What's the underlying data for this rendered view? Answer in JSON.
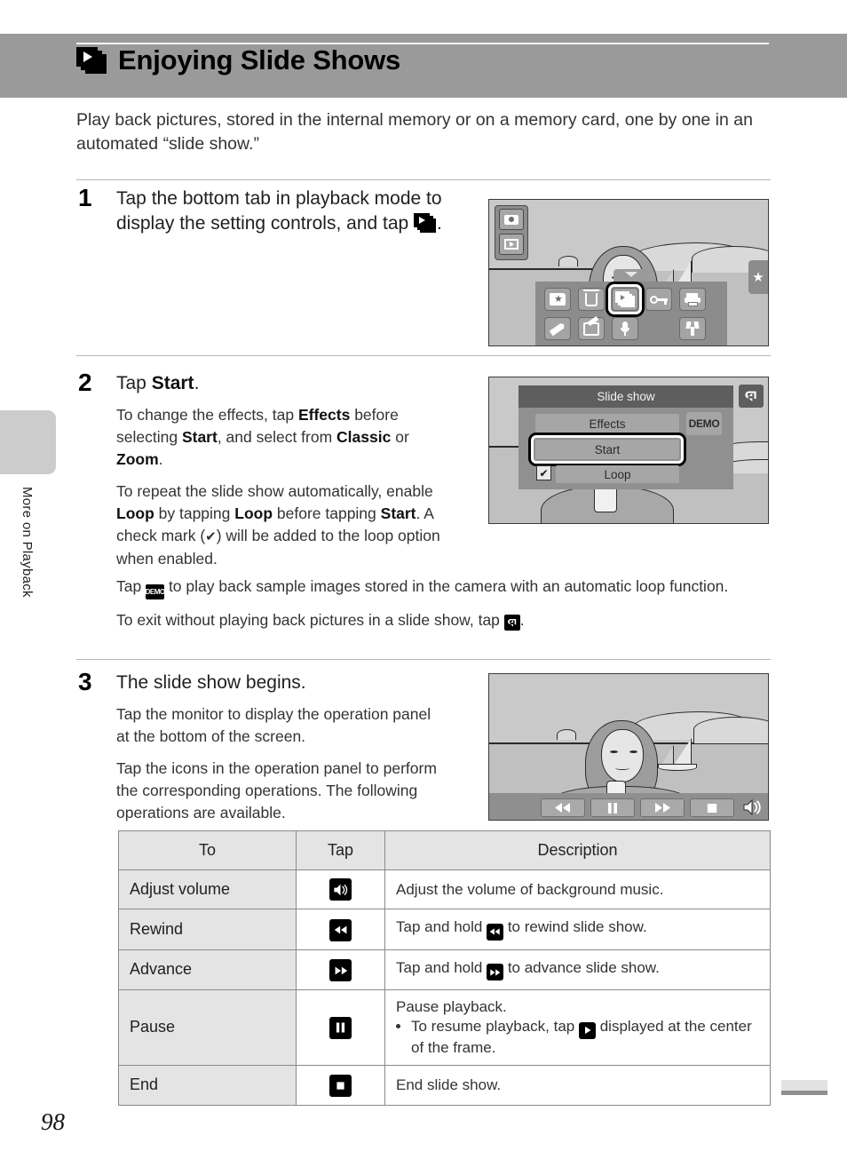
{
  "header": {
    "title": "Enjoying Slide Shows",
    "icon": "slide-show-icon"
  },
  "intro": "Play back pictures, stored in the internal memory or on a memory card, one by one in an automated “slide show.”",
  "steps": [
    {
      "number": "1",
      "heading_part1": "Tap the bottom tab in playback mode to display the setting controls, and tap ",
      "heading_part2": ".",
      "figure": {
        "name": "playback-setting-controls-screen",
        "mode_buttons": [
          "camera-mode-icon",
          "playback-mode-icon"
        ],
        "panel_icons_row1": [
          "favorites-folder-icon",
          "delete-trash-icon",
          "slide-show-icon",
          "protect-key-icon",
          "print-order-icon"
        ],
        "panel_icons_row2": [
          "d-lighting-pencil-icon",
          "edit-retouch-icon",
          "voice-memo-mic-icon",
          "setup-wrench-icon"
        ],
        "selected_icon": "slide-show-icon",
        "side_tab_icon": "favorites-star-icon"
      }
    },
    {
      "number": "2",
      "heading_plain": "Tap ",
      "heading_bold": "Start",
      "heading_end": ".",
      "paragraphs": [
        "To change the effects, tap |Effects| before selecting |Start|, and select from |Classic| or |Zoom|.",
        "To repeat the slide show automatically, enable |Loop| by tapping |Loop| before tapping |Start|. A check mark (✔) will be added to the loop option when enabled.",
        "Tap [DEMO] to play back sample images stored in the camera with an automatic loop function.",
        "To exit without playing back pictures in a slide show, tap [BACK]."
      ],
      "figure": {
        "name": "slide-show-menu-screen",
        "menu_title": "Slide show",
        "items": [
          "Effects",
          "Start",
          "Loop"
        ],
        "demo_label": "DEMO",
        "selected_item": "Start",
        "loop_checked": true,
        "back_button": "back-arrow-icon"
      }
    },
    {
      "number": "3",
      "heading": "The slide show begins.",
      "paragraphs": [
        "Tap the monitor to display the operation panel at the bottom of the screen.",
        "Tap the icons in the operation panel to perform the corresponding operations. The following operations are available."
      ],
      "figure": {
        "name": "slide-show-playback-screen",
        "op_panel_icons": [
          "rewind-icon",
          "pause-icon",
          "advance-icon",
          "end-stop-icon",
          "volume-icon"
        ]
      }
    }
  ],
  "table": {
    "headers": [
      "To",
      "Tap",
      "Description"
    ],
    "rows": [
      {
        "to": "Adjust volume",
        "tap_icon": "volume-icon",
        "description": "Adjust the volume of background music.",
        "desc_pre": "Adjust the volume of background music.",
        "desc_post": ""
      },
      {
        "to": "Rewind",
        "tap_icon": "rewind-icon",
        "description": "Tap and hold [REWIND] to rewind slide show.",
        "desc_pre": "Tap and hold ",
        "desc_post": " to rewind slide show."
      },
      {
        "to": "Advance",
        "tap_icon": "advance-icon",
        "description": "Tap and hold [ADVANCE] to advance slide show.",
        "desc_pre": "Tap and hold ",
        "desc_post": " to advance slide show."
      },
      {
        "to": "Pause",
        "tap_icon": "pause-icon",
        "description": "Pause playback.",
        "desc_pre": "Pause playback.",
        "bullet_pre": "To resume playback, tap ",
        "bullet_post": " displayed at the center of the frame."
      },
      {
        "to": "End",
        "tap_icon": "end-stop-icon",
        "description": "End slide show.",
        "desc_pre": "End slide show.",
        "desc_post": ""
      }
    ]
  },
  "sidebar": {
    "section_label": "More on Playback"
  },
  "footer": {
    "page_number": "98"
  },
  "colors": {
    "banner": "#9a9a9a",
    "rule": "#b5b5b5",
    "table_header": "#e4e4e4",
    "side_tab": "#cccccc"
  }
}
